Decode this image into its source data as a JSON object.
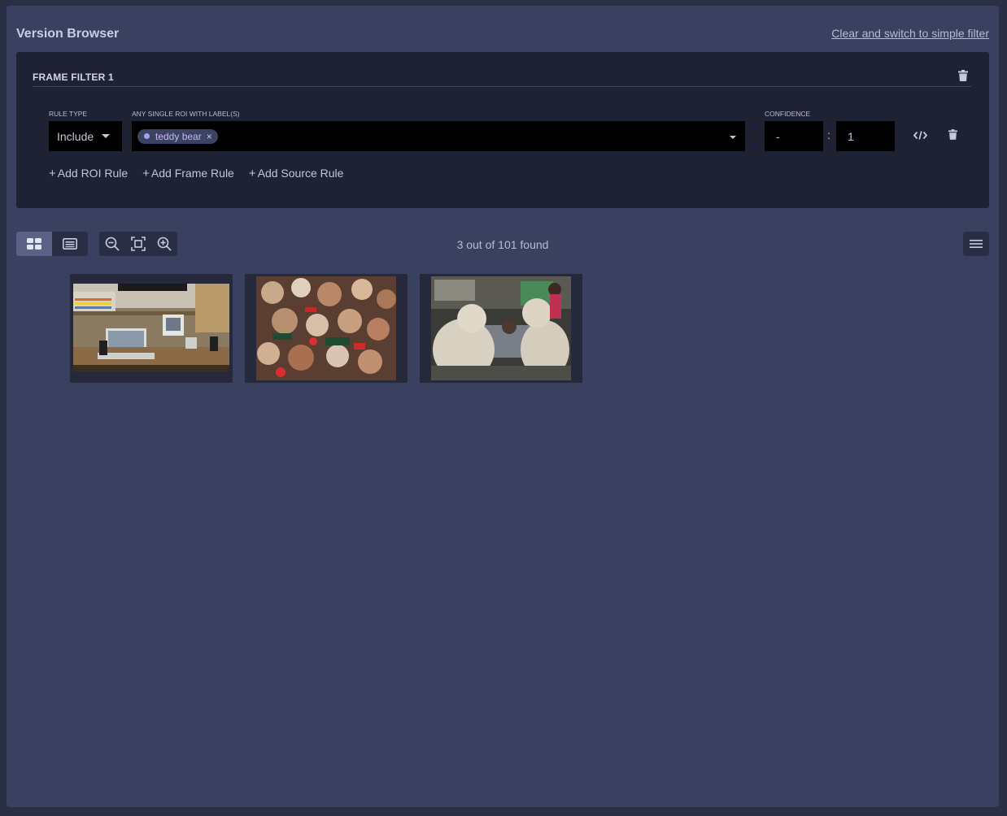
{
  "header": {
    "title": "Version Browser",
    "switch_link": "Clear and switch to simple filter"
  },
  "filter": {
    "title": "FRAME FILTER 1",
    "rule_type_label": "RULE TYPE",
    "rule_type_value": "Include",
    "roi_label": "ANY SINGLE ROI WITH LABEL(S)",
    "chips": [
      "teddy bear"
    ],
    "confidence_label": "CONFIDENCE",
    "confidence_min": "-",
    "confidence_max": "1",
    "colon": ":",
    "add_roi": "Add ROI Rule",
    "add_frame": "Add Frame Rule",
    "add_source": "Add Source Rule",
    "plus": "+"
  },
  "results": {
    "count_text": "3 out of 101 found"
  },
  "colors": {
    "background": "#394060",
    "filter_bg": "#1f2232",
    "chip_bg": "#3c4362",
    "chip_text": "#c3b9f0",
    "active_view": "#5a6288"
  },
  "icons": [
    "trash-icon",
    "caret-down-icon",
    "code-icon",
    "grid-view-icon",
    "list-view-icon",
    "zoom-out-icon",
    "fit-icon",
    "zoom-in-icon",
    "menu-icon",
    "plus-icon",
    "close-icon"
  ]
}
